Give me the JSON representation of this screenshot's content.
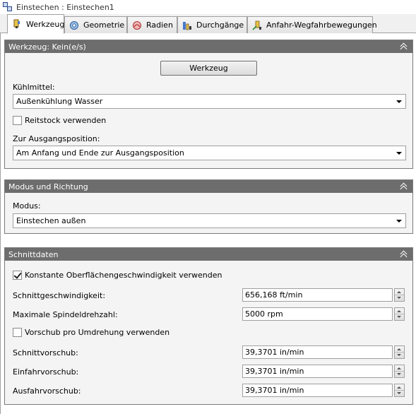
{
  "window": {
    "title": "Einstechen : Einstechen1"
  },
  "tabs": [
    {
      "label": "Werkzeug",
      "icon": "tool-holder-icon",
      "active": true
    },
    {
      "label": "Geometrie",
      "icon": "geometry-icon",
      "active": false
    },
    {
      "label": "Radien",
      "icon": "radii-icon",
      "active": false
    },
    {
      "label": "Durchgänge",
      "icon": "passes-icon",
      "active": false
    },
    {
      "label": "Anfahr-Wegfahrbewegungen",
      "icon": "linking-icon",
      "active": false
    }
  ],
  "tool_panel": {
    "title": "Werkzeug: Kein(e/s)",
    "tool_button": "Werkzeug",
    "coolant_label": "Kühlmittel:",
    "coolant_value": "Außenkühlung Wasser",
    "tailstock_label": "Reitstock verwenden",
    "tailstock_checked": false,
    "home_label": "Zur Ausgangsposition:",
    "home_value": "Am Anfang und Ende zur Ausgangsposition"
  },
  "mode_panel": {
    "title": "Modus und Richtung",
    "mode_label": "Modus:",
    "mode_value": "Einstechen außen"
  },
  "cut_panel": {
    "title": "Schnittdaten",
    "css_label": "Konstante Oberflächengeschwindigkeit verwenden",
    "css_checked": true,
    "cutting_speed_label": "Schnittgeschwindigkeit:",
    "cutting_speed_value": "656,168 ft/min",
    "max_spindle_label": "Maximale Spindeldrehzahl:",
    "max_spindle_value": "5000 rpm",
    "feed_per_rev_label": "Vorschub pro Umdrehung verwenden",
    "feed_per_rev_checked": false,
    "cutting_feed_label": "Schnittvorschub:",
    "cutting_feed_value": "39,3701 in/min",
    "lead_in_label": "Einfahrvorschub:",
    "lead_in_value": "39,3701 in/min",
    "lead_out_label": "Ausfahrvorschub:",
    "lead_out_value": "39,3701 in/min"
  },
  "colors": {
    "panel_header": "#6d6d6d",
    "panel_body": "#f4f4f4",
    "tab_bg": "#e3e3e3"
  }
}
